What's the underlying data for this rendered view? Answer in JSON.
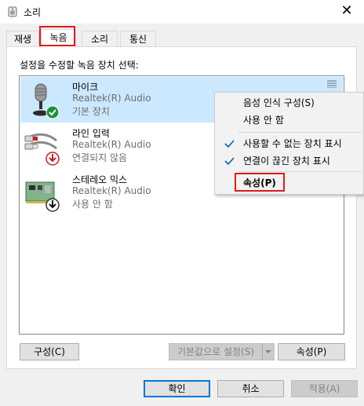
{
  "window": {
    "title": "소리",
    "close_icon": "close-icon",
    "app_icon": "speaker-icon"
  },
  "tabs": [
    {
      "label": "재생"
    },
    {
      "label": "녹음",
      "selected": true
    },
    {
      "label": "소리"
    },
    {
      "label": "통신"
    }
  ],
  "instruction": "설정을 수정할 녹음 장치 선택:",
  "devices": [
    {
      "name": "마이크",
      "driver": "Realtek(R) Audio",
      "status": "기본 장치",
      "icon": "microphone-icon",
      "badge": "default-check-icon",
      "selected": true
    },
    {
      "name": "라인 입력",
      "driver": "Realtek(R) Audio",
      "status": "연결되지 않음",
      "icon": "line-in-cable-icon",
      "badge": "disconnected-icon"
    },
    {
      "name": "스테레오 믹스",
      "driver": "Realtek(R) Audio",
      "status": "사용 안 함",
      "icon": "sound-card-icon",
      "badge": "disabled-icon"
    }
  ],
  "context_menu": {
    "items": [
      {
        "label": "음성 인식 구성(S)",
        "checked": false
      },
      {
        "label": "사용 안 함",
        "checked": false
      },
      {
        "label": "사용할 수 없는 장치 표시",
        "checked": true
      },
      {
        "label": "연결이 끊긴 장치 표시",
        "checked": true
      },
      {
        "label": "속성(P)",
        "checked": false,
        "bold": true
      }
    ]
  },
  "panel_buttons": {
    "configure": "구성(C)",
    "set_default": "기본값으로 설정(S)",
    "properties": "속성(P)"
  },
  "dialog_buttons": {
    "ok": "확인",
    "cancel": "취소",
    "apply": "적용(A)"
  },
  "colors": {
    "selection": "#cce8ff",
    "highlight_box": "#e01b1b",
    "default_button_border": "#0078d7"
  }
}
